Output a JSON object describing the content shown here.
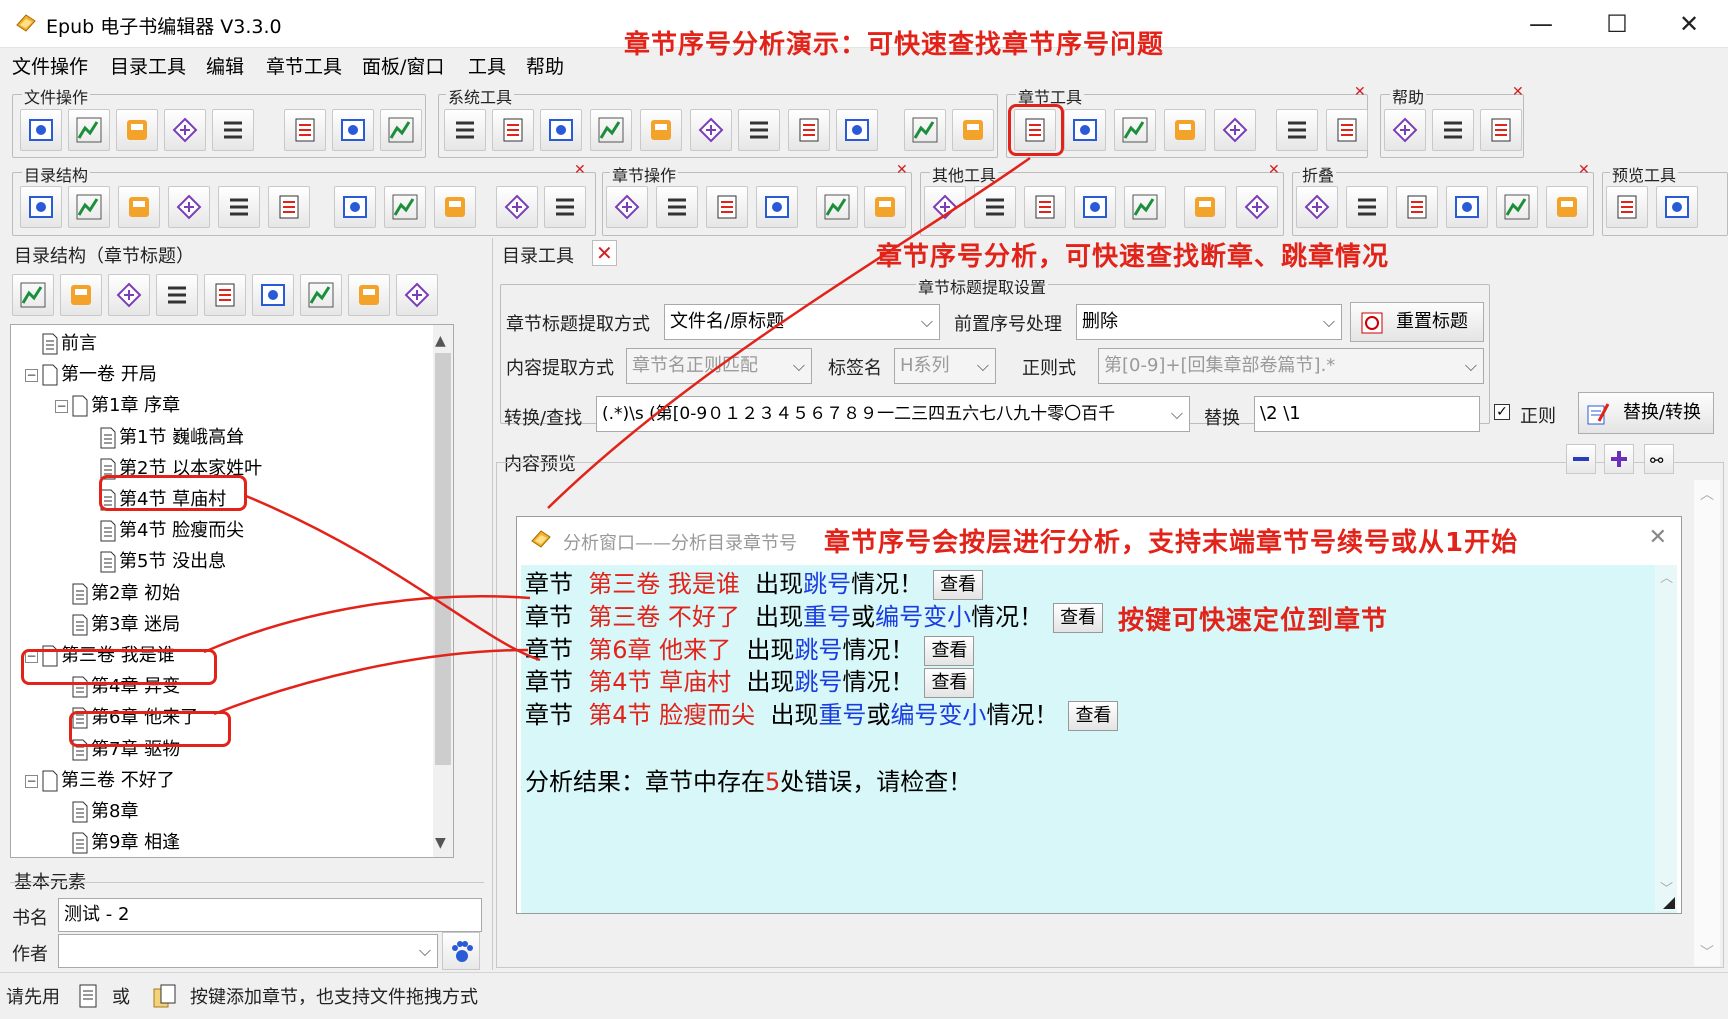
{
  "window": {
    "title": "Epub 电子书编辑器 V3.3.0",
    "minimize": "—",
    "maximize": "☐",
    "close": "✕"
  },
  "menu": [
    "文件操作",
    "目录工具",
    "编辑",
    "章节工具",
    "面板/窗口",
    "工具",
    "帮助"
  ],
  "annotations": {
    "top": "章节序号分析演示：可快速查找章节序号问题",
    "mid": "章节序号分析，可快速查找断章、跳章情况",
    "dialog": "章节序号会按层进行分析，支持末端章节号续号或从1开始",
    "button": "按键可快速定位到章节"
  },
  "toolbar_groups": [
    "文件操作",
    "系统工具",
    "章节工具",
    "帮助",
    "目录结构",
    "章节操作",
    "其他工具",
    "折叠",
    "预览工具"
  ],
  "left_panel": {
    "title": "目录结构（章节标题）",
    "tree": [
      {
        "label": "前言"
      },
      {
        "label": "第一卷 开局"
      },
      {
        "label": "第1章 序章"
      },
      {
        "label": "第1节 巍峨高耸"
      },
      {
        "label": "第2节 以本家姓叶"
      },
      {
        "label": "第4节 草庙村"
      },
      {
        "label": "第4节 脸瘦而尖"
      },
      {
        "label": "第5节 没出息"
      },
      {
        "label": "第2章 初始"
      },
      {
        "label": "第3章 迷局"
      },
      {
        "label": "第三卷 我是谁"
      },
      {
        "label": "第4章 异变"
      },
      {
        "label": "第6章 他来了"
      },
      {
        "label": "第7章 驱物"
      },
      {
        "label": "第三卷 不好了"
      },
      {
        "label": "第8章"
      },
      {
        "label": "第9章 相逢"
      }
    ],
    "basic_title": "基本元素",
    "book_label": "书名",
    "book_value": "测试 - 2",
    "author_label": "作者",
    "author_value": ""
  },
  "right_panel": {
    "tab_title": "目录工具",
    "settings_title": "章节标题提取设置",
    "extract_label": "章节标题提取方式",
    "extract_value": "文件名/原标题",
    "prefix_label": "前置序号处理",
    "prefix_value": "删除",
    "reset_button": "重置标题",
    "content_label": "内容提取方式",
    "content_value": "章节名正则匹配",
    "tag_label": "标签名",
    "tag_value": "H系列",
    "regex_label": "正则式",
    "regex_value": "第[0-9]+[回集章部卷篇节].*",
    "convert_label": "转换/查找",
    "convert_value": "(.*)\\s (第[0-9０１２３４５６７８９一二三四五六七八九十零〇百千",
    "replace_label": "替换",
    "replace_value": "\\2 \\1",
    "regex_check_label": "正则",
    "replace_button": "替换/转换",
    "preview_title": "内容预览"
  },
  "dialog": {
    "title": "分析窗口——分析目录章节号",
    "results": [
      {
        "prefix": "章节",
        "name": "第三卷  我是谁",
        "pre": "出现",
        "b1": "跳号",
        "mid": "",
        "b2": "",
        "post": "情况！"
      },
      {
        "prefix": "章节",
        "name": "第三卷  不好了",
        "pre": "出现",
        "b1": "重号",
        "mid": "或",
        "b2": "编号变小",
        "post": "情况！"
      },
      {
        "prefix": "章节",
        "name": "第6章  他来了",
        "pre": "出现",
        "b1": "跳号",
        "mid": "",
        "b2": "",
        "post": "情况！"
      },
      {
        "prefix": "章节",
        "name": "第4节  草庙村",
        "pre": "出现",
        "b1": "跳号",
        "mid": "",
        "b2": "",
        "post": "情况！"
      },
      {
        "prefix": "章节",
        "name": "第4节  脸瘦而尖",
        "pre": "出现",
        "b1": "重号",
        "mid": "或",
        "b2": "编号变小",
        "post": "情况！"
      }
    ],
    "view_button": "查看",
    "summary_pre": "分析结果：章节中存在",
    "summary_count": "5",
    "summary_post": "处错误，请检查！"
  },
  "status": {
    "p1": "请先用",
    "p2": "或",
    "p3": "按键添加章节，也支持文件拖拽方式"
  },
  "colors": {
    "annotation": "#e2231a",
    "highlight_blue": "#1a3ce0",
    "dialog_bg": "#d7f7f9"
  }
}
